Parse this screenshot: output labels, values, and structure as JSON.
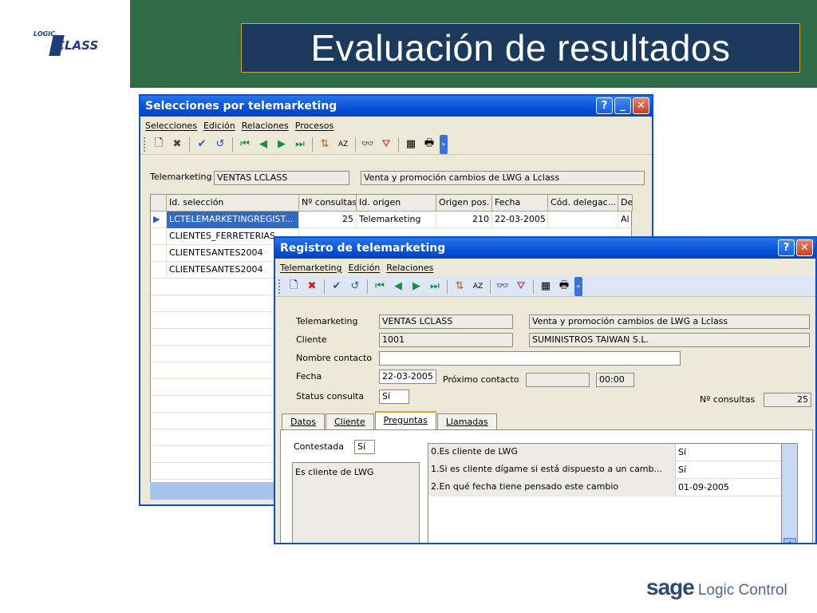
{
  "slide": {
    "title": "Evaluación de resultados",
    "logo_small": "LOGIC",
    "logo_big": "CLASS",
    "footer_brand": "sage",
    "footer_product": "Logic Control"
  },
  "win1": {
    "title": "Selecciones por telemarketing",
    "menu": [
      "Selecciones",
      "Edición",
      "Relaciones",
      "Procesos"
    ],
    "label_telemarketing": "Telemarketing",
    "telemarketing_code": "VENTAS LCLASS",
    "telemarketing_desc": "Venta y promoción cambios de LWG a Lclass",
    "columns": [
      "Id. selección",
      "Nº consultas",
      "Id. origen",
      "Origen pos.",
      "Fecha",
      "Cód. delegac...",
      "De"
    ],
    "rows": [
      {
        "id": "LCTELEMARKETINGREGIST...",
        "consultas": "25",
        "origen": "Telemarketing",
        "pos": "210",
        "fecha": "22-03-2005",
        "deleg": "",
        "de": "Al"
      },
      {
        "id": "CLIENTES_FERRETERIAS",
        "consultas": "",
        "origen": "",
        "pos": "",
        "fecha": "",
        "deleg": "",
        "de": ""
      },
      {
        "id": "CLIENTESANTES2004",
        "consultas": "",
        "origen": "",
        "pos": "",
        "fecha": "",
        "deleg": "",
        "de": ""
      },
      {
        "id": "CLIENTESANTES2004",
        "consultas": "",
        "origen": "",
        "pos": "",
        "fecha": "",
        "deleg": "",
        "de": ""
      }
    ]
  },
  "win2": {
    "title": "Registro de telemarketing",
    "menu": [
      "Telemarketing",
      "Edición",
      "Relaciones"
    ],
    "label_telemarketing": "Telemarketing",
    "telemarketing_code": "VENTAS LCLASS",
    "telemarketing_desc": "Venta y promoción cambios de LWG a Lclass",
    "label_cliente": "Cliente",
    "cliente_code": "1001",
    "cliente_name": "SUMINISTROS TAIWAN S.L.",
    "label_nombre": "Nombre contacto",
    "nombre_value": "",
    "label_fecha": "Fecha",
    "fecha_value": "22-03-2005",
    "label_proximo": "Próximo contacto",
    "proximo_date": "",
    "proximo_time": "00:00",
    "label_status": "Status consulta",
    "status_value": "Sí",
    "label_nconsultas": "Nº consultas",
    "nconsultas_value": "25",
    "tabs": [
      "Datos",
      "Cliente",
      "Preguntas",
      "Llamadas"
    ],
    "active_tab": "Preguntas",
    "label_contestada": "Contestada",
    "contestada_value": "Sí",
    "memo_text": "Es cliente de LWG",
    "questions": [
      {
        "q": "0.Es cliente de LWG",
        "a": "Sí"
      },
      {
        "q": "1.Si es cliente dígame si está dispuesto a un camb...",
        "a": "Sí"
      },
      {
        "q": "2.En qué fecha tiene pensado este cambio",
        "a": "01-09-2005"
      }
    ]
  }
}
